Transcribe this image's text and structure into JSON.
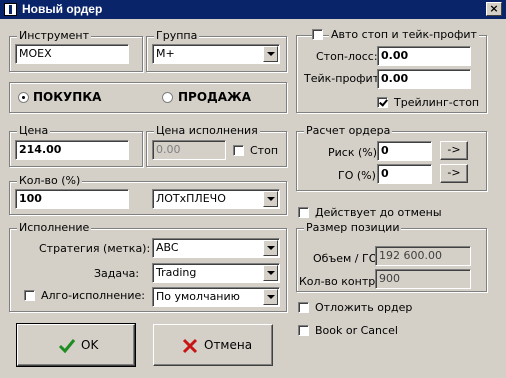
{
  "window": {
    "title": "Новый ордер",
    "close_label": "×"
  },
  "instrument": {
    "group_label": "Инструмент",
    "value": "MOEX"
  },
  "group": {
    "group_label": "Группа",
    "value": "M+"
  },
  "side": {
    "buy_label": "ПОКУПКА",
    "sell_label": "ПРОДАЖА",
    "selected": "buy"
  },
  "price": {
    "group_label": "Цена",
    "value": "214.00"
  },
  "exec_price": {
    "group_label": "Цена исполнения",
    "value": "0.00",
    "stop_label": "Стоп"
  },
  "qty": {
    "group_label": "Кол-во (%)",
    "value": "100",
    "unit": "ЛОТхПЛЕЧО"
  },
  "execution": {
    "group_label": "Исполнение",
    "strategy_label": "Стратегия (метка):",
    "strategy_value": "ABC",
    "task_label": "Задача:",
    "task_value": "Trading",
    "algo_label": "Алго-исполнение:",
    "algo_value": "По умолчанию"
  },
  "auto_stop": {
    "group_label": "Авто стоп и тейк-профит",
    "stop_loss_label": "Стоп-лосс:",
    "stop_loss_value": "0.00",
    "take_profit_label": "Тейк-профит:",
    "take_profit_value": "0.00",
    "trailing_label": "Трейлинг-стоп",
    "trailing_checked": true
  },
  "calc": {
    "group_label": "Расчет ордера",
    "risk_label": "Риск (%):",
    "risk_value": "0",
    "go_label": "ГО (%):",
    "go_value": "0",
    "arrow_label": "->"
  },
  "gtc_label": "Действует до отмены",
  "position": {
    "group_label": "Размер позиции",
    "volume_label": "Объем / ГО:",
    "volume_value": "192 600.00",
    "contracts_label": "Кол-во контр.:",
    "contracts_value": "900"
  },
  "defer_label": "Отложить ордер",
  "boc_label": "Book or Cancel",
  "buttons": {
    "ok_label": "OK",
    "cancel_label": "Отмена"
  },
  "colors": {
    "titlebar": "#0a246a",
    "ok_icon": "#1e8c1e",
    "cancel_icon": "#c81414",
    "face": "#d4d0c8"
  }
}
